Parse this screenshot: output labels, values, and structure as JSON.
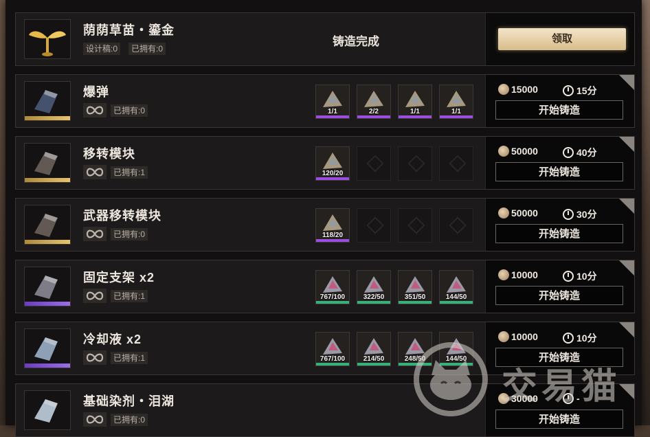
{
  "header_row": {
    "name": "荫荫草苗・鎏金",
    "tag_design": "设计稿:0",
    "tag_owned": "已拥有:0",
    "status": "铸造完成",
    "claim_label": "领取"
  },
  "rows": [
    {
      "name": "爆弹",
      "owned": "已拥有:0",
      "cost": "15000",
      "time": "15分",
      "forge": "开始铸造",
      "mats": [
        {
          "count": "1/1",
          "bar": "purple"
        },
        {
          "count": "2/2",
          "bar": "purple"
        },
        {
          "count": "1/1",
          "bar": "purple"
        },
        {
          "count": "1/1",
          "bar": "purple"
        }
      ]
    },
    {
      "name": "移转模块",
      "owned": "已拥有:1",
      "cost": "50000",
      "time": "40分",
      "forge": "开始铸造",
      "mats": [
        {
          "count": "120/20",
          "bar": "purple"
        }
      ]
    },
    {
      "name": "武器移转模块",
      "owned": "已拥有:0",
      "cost": "50000",
      "time": "30分",
      "forge": "开始铸造",
      "mats": [
        {
          "count": "118/20",
          "bar": "purple"
        }
      ]
    },
    {
      "name": "固定支架 x2",
      "owned": "已拥有:1",
      "cost": "10000",
      "time": "10分",
      "forge": "开始铸造",
      "mats": [
        {
          "count": "767/100",
          "bar": "green"
        },
        {
          "count": "322/50",
          "bar": "green"
        },
        {
          "count": "351/50",
          "bar": "green"
        },
        {
          "count": "144/50",
          "bar": "green"
        }
      ]
    },
    {
      "name": "冷却液 x2",
      "owned": "已拥有:1",
      "cost": "10000",
      "time": "10分",
      "forge": "开始铸造",
      "mats": [
        {
          "count": "767/100",
          "bar": "green"
        },
        {
          "count": "214/50",
          "bar": "green"
        },
        {
          "count": "248/50",
          "bar": "green"
        },
        {
          "count": "144/50",
          "bar": "green"
        }
      ]
    },
    {
      "name": "基础染剂・泪湖",
      "owned": "已拥有:0",
      "cost": "30000",
      "time": "-",
      "forge": "开始铸造",
      "mats": []
    }
  ],
  "watermark": "交易猫",
  "colors": {
    "gold": "#e8c36c",
    "purple": "#9a4de0",
    "green": "#37b07a"
  }
}
